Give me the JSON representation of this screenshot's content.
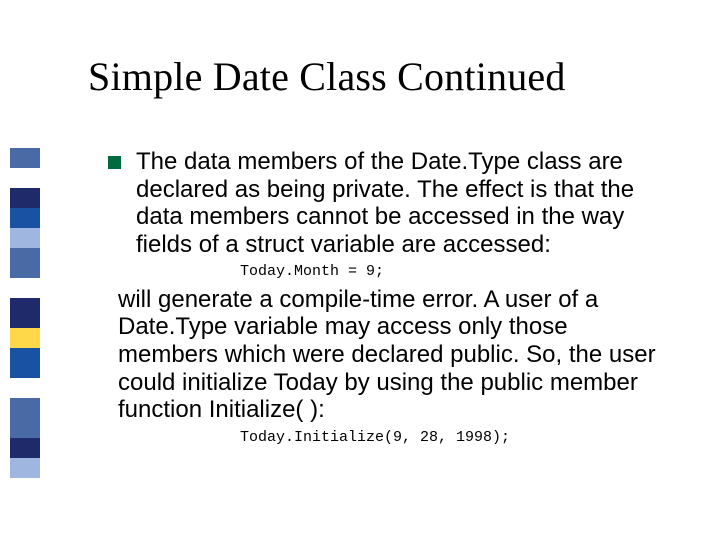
{
  "title": "Simple Date Class Continued",
  "bullet": {
    "para1": "The data members of the Date.Type class are declared as being private.  The effect is that the data members cannot be accessed in the way fields of a struct variable are accessed:",
    "code1": "Today.Month = 9;",
    "para2": " will generate a compile-time error.  A user of a Date.Type variable may access only those members which were declared public.   So, the user could initialize Today by using the public member function Initialize( ):",
    "code2": "Today.Initialize(9, 28, 1998);"
  },
  "sidebar_colors": [
    {
      "c": "#4a6aa5",
      "h": 20
    },
    {
      "c": "#ffffff",
      "h": 20
    },
    {
      "c": "#1f2a6b",
      "h": 20
    },
    {
      "c": "#1a52a3",
      "h": 20
    },
    {
      "c": "#9fb7e0",
      "h": 20
    },
    {
      "c": "#4a6aa5",
      "h": 30
    },
    {
      "c": "#ffffff",
      "h": 20
    },
    {
      "c": "#1f2a6b",
      "h": 30
    },
    {
      "c": "#ffd84a",
      "h": 20
    },
    {
      "c": "#1a52a3",
      "h": 30
    },
    {
      "c": "#ffffff",
      "h": 20
    },
    {
      "c": "#4a6aa5",
      "h": 40
    },
    {
      "c": "#1f2a6b",
      "h": 20
    },
    {
      "c": "#9fb7e0",
      "h": 20
    }
  ]
}
